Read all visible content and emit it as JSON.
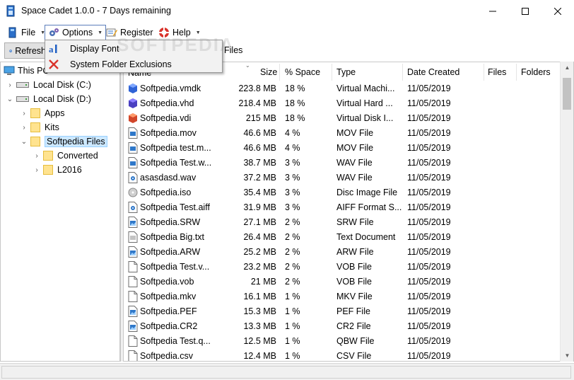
{
  "window": {
    "title": "Space Cadet 1.0.0 - 7 Days remaining",
    "minimize_glyph": "—",
    "maximize_glyph": "☐",
    "close_glyph": "✕"
  },
  "menu": {
    "file": "File",
    "options": "Options",
    "register": "Register",
    "help": "Help"
  },
  "toolbar": {
    "refresh_label": "Refresh",
    "current_folder": "Files"
  },
  "options_menu": {
    "items": [
      {
        "label": "Display Font",
        "icon": "font-icon"
      },
      {
        "label": "System Folder Exclusions",
        "icon": "red-x-icon"
      }
    ]
  },
  "watermark": "SOFTPEDIA",
  "tree": {
    "items": [
      {
        "label": "This PC",
        "level": 0,
        "icon": "pc-icon",
        "chevron": ""
      },
      {
        "label": "Local Disk (C:)",
        "level": 1,
        "icon": "drive-icon",
        "chevron": "›"
      },
      {
        "label": "Local Disk (D:)",
        "level": 1,
        "icon": "drive-icon",
        "chevron": "⌄"
      },
      {
        "label": "Apps",
        "level": 2,
        "icon": "folder-icon",
        "chevron": "›"
      },
      {
        "label": "Kits",
        "level": 2,
        "icon": "folder-icon",
        "chevron": "›"
      },
      {
        "label": "Softpedia Files",
        "level": 2,
        "icon": "folder-icon",
        "chevron": "⌄",
        "selected": true
      },
      {
        "label": "Converted",
        "level": 3,
        "icon": "folder-icon",
        "chevron": "›"
      },
      {
        "label": "L2016",
        "level": 3,
        "icon": "folder-icon",
        "chevron": "›"
      }
    ]
  },
  "columns": {
    "name": "Name",
    "size": "Size",
    "percent": "% Space",
    "type": "Type",
    "date": "Date Created",
    "files": "Files",
    "folders": "Folders"
  },
  "files": [
    {
      "name": "Softpedia.vmdk",
      "size": "223.8 MB",
      "pct": "18 %",
      "type": "Virtual Machi...",
      "date": "11/05/2019",
      "icon": "cube-blue-icon"
    },
    {
      "name": "Softpedia.vhd",
      "size": "218.4 MB",
      "pct": "18 %",
      "type": "Virtual Hard ...",
      "date": "11/05/2019",
      "icon": "cube-purple-icon"
    },
    {
      "name": "Softpedia.vdi",
      "size": "215 MB",
      "pct": "18 %",
      "type": "Virtual Disk I...",
      "date": "11/05/2019",
      "icon": "cube-orange-icon"
    },
    {
      "name": "Softpedia.mov",
      "size": "46.6 MB",
      "pct": "4 %",
      "type": "MOV File",
      "date": "11/05/2019",
      "icon": "media-file-icon"
    },
    {
      "name": "Softpedia test.m...",
      "size": "46.6 MB",
      "pct": "4 %",
      "type": "MOV File",
      "date": "11/05/2019",
      "icon": "media-file-icon"
    },
    {
      "name": "Softpedia Test.w...",
      "size": "38.7 MB",
      "pct": "3 %",
      "type": "WAV File",
      "date": "11/05/2019",
      "icon": "media-file-icon"
    },
    {
      "name": "asasdasd.wav",
      "size": "37.2 MB",
      "pct": "3 %",
      "type": "WAV File",
      "date": "11/05/2019",
      "icon": "audio-file-icon"
    },
    {
      "name": "Softpedia.iso",
      "size": "35.4 MB",
      "pct": "3 %",
      "type": "Disc Image File",
      "date": "11/05/2019",
      "icon": "disc-file-icon"
    },
    {
      "name": "Softpedia Test.aiff",
      "size": "31.9 MB",
      "pct": "3 %",
      "type": "AIFF Format S...",
      "date": "11/05/2019",
      "icon": "audio-file-icon"
    },
    {
      "name": "Softpedia.SRW",
      "size": "27.1 MB",
      "pct": "2 %",
      "type": "SRW File",
      "date": "11/05/2019",
      "icon": "image-file-icon"
    },
    {
      "name": "Softpedia Big.txt",
      "size": "26.4 MB",
      "pct": "2 %",
      "type": "Text Document",
      "date": "11/05/2019",
      "icon": "text-file-icon"
    },
    {
      "name": "Softpedia.ARW",
      "size": "25.2 MB",
      "pct": "2 %",
      "type": "ARW File",
      "date": "11/05/2019",
      "icon": "image-file-icon"
    },
    {
      "name": "Softpedia Test.v...",
      "size": "23.2 MB",
      "pct": "2 %",
      "type": "VOB File",
      "date": "11/05/2019",
      "icon": "blank-file-icon"
    },
    {
      "name": "Softpedia.vob",
      "size": "21 MB",
      "pct": "2 %",
      "type": "VOB File",
      "date": "11/05/2019",
      "icon": "blank-file-icon"
    },
    {
      "name": "Softpedia.mkv",
      "size": "16.1 MB",
      "pct": "1 %",
      "type": "MKV File",
      "date": "11/05/2019",
      "icon": "blank-file-icon"
    },
    {
      "name": "Softpedia.PEF",
      "size": "15.3 MB",
      "pct": "1 %",
      "type": "PEF File",
      "date": "11/05/2019",
      "icon": "image-file-icon"
    },
    {
      "name": "Softpedia.CR2",
      "size": "13.3 MB",
      "pct": "1 %",
      "type": "CR2 File",
      "date": "11/05/2019",
      "icon": "image-file-icon"
    },
    {
      "name": "Softpedia Test.q...",
      "size": "12.5 MB",
      "pct": "1 %",
      "type": "QBW File",
      "date": "11/05/2019",
      "icon": "blank-file-icon"
    },
    {
      "name": "Softpedia.csv",
      "size": "12.4 MB",
      "pct": "1 %",
      "type": "CSV File",
      "date": "11/05/2019",
      "icon": "blank-file-icon"
    }
  ],
  "colors": {
    "selection_bg": "#cce8ff",
    "selection_border": "#99d1ff",
    "menu_active_border": "#5b7dbb"
  }
}
